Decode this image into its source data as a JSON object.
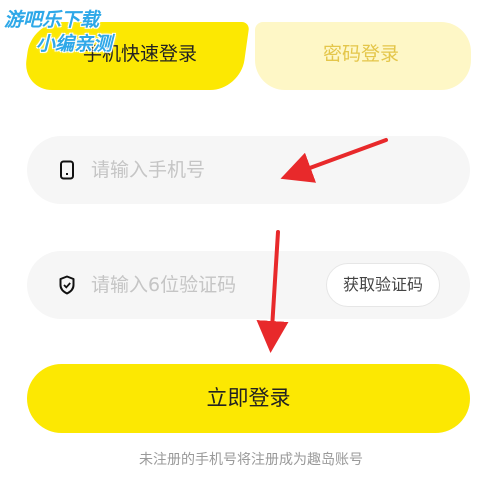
{
  "tabs": {
    "quick_login": "手机快速登录",
    "password_login": "密码登录"
  },
  "phone_field": {
    "icon": "phone-icon",
    "placeholder": "请输入手机号"
  },
  "code_field": {
    "icon": "shield-check-icon",
    "placeholder": "请输入6位验证码",
    "get_code_label": "获取验证码"
  },
  "login_button": "立即登录",
  "note": "未注册的手机号将注册成为趣岛账号",
  "watermark": {
    "line1": "游吧乐下载",
    "line2": "小编亲测"
  },
  "colors": {
    "accent": "#FCE802",
    "accent_light": "#FEF7C6",
    "inactive_text": "#E4C64A",
    "field_bg": "#F6F6F6",
    "annotation_arrow": "#E8292B",
    "watermark": "#2EA8E8"
  }
}
